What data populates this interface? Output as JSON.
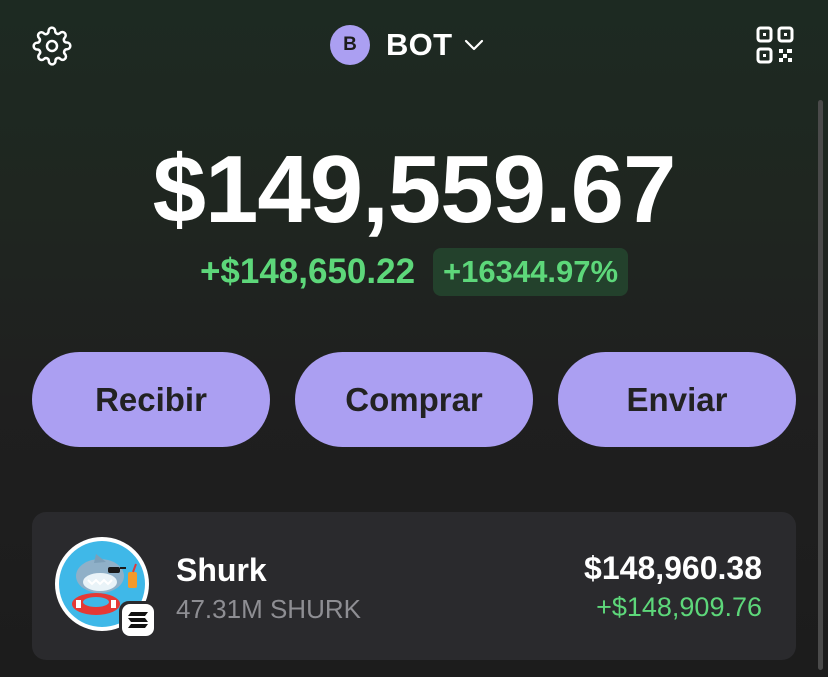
{
  "header": {
    "settings_icon": "gear-icon",
    "account": {
      "avatar_letter": "B",
      "name": "BOT",
      "chevron_icon": "chevron-down-icon"
    },
    "qr_icon": "qr-code-icon"
  },
  "portfolio": {
    "balance": "$149,559.67",
    "change_amount": "+$148,650.22",
    "change_percent": "+16344.97%"
  },
  "actions": [
    {
      "label": "Recibir"
    },
    {
      "label": "Comprar"
    },
    {
      "label": "Enviar"
    }
  ],
  "tokens": [
    {
      "name": "Shurk",
      "quantity": "47.31M SHURK",
      "value": "$148,960.38",
      "change": "+$148,909.76",
      "logo_icon": "shark-mascot-icon",
      "chain_icon": "solana-icon"
    }
  ],
  "colors": {
    "accent": "#ab9ff2",
    "positive": "#5dd77a",
    "card": "#2a2a2d",
    "muted_text": "#8e8e93"
  }
}
